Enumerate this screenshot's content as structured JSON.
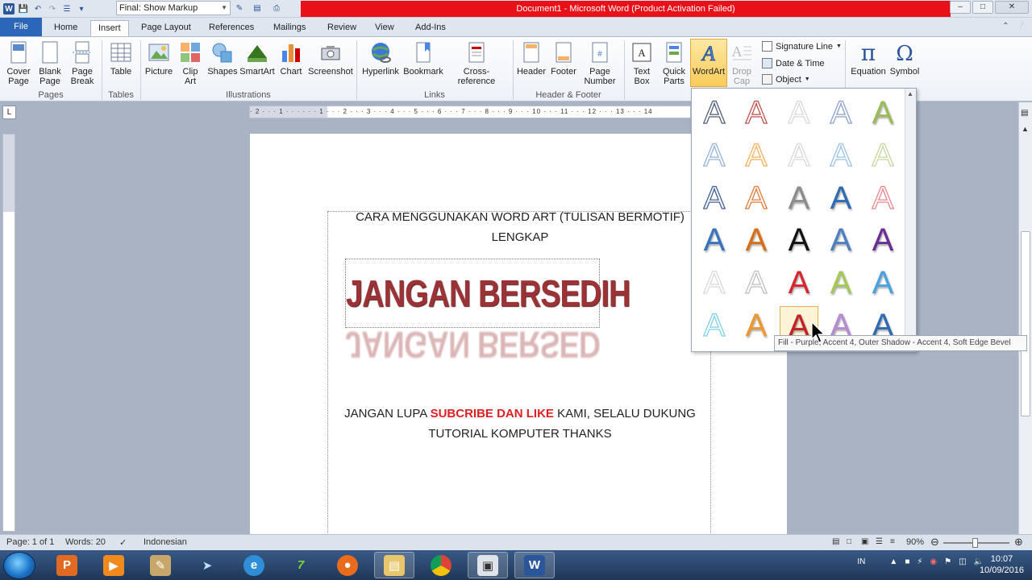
{
  "titlebar": {
    "markup_select": "Final: Show Markup",
    "window_title": "Document1  -  Microsoft Word (Product Activation Failed)"
  },
  "tabs": [
    "File",
    "Home",
    "Insert",
    "Page Layout",
    "References",
    "Mailings",
    "Review",
    "View",
    "Add-Ins"
  ],
  "ribbon": {
    "pages": {
      "cover_page": "Cover Page",
      "blank_page": "Blank Page",
      "page_break": "Page Break",
      "label": "Pages"
    },
    "tables": {
      "table": "Table",
      "label": "Tables"
    },
    "illustrations": {
      "picture": "Picture",
      "clip_art": "Clip Art",
      "shapes": "Shapes",
      "smartart": "SmartArt",
      "chart": "Chart",
      "screenshot": "Screenshot",
      "label": "Illustrations"
    },
    "links": {
      "hyperlink": "Hyperlink",
      "bookmark": "Bookmark",
      "cross_reference": "Cross-reference",
      "label": "Links"
    },
    "header_footer": {
      "header": "Header",
      "footer": "Footer",
      "page_number": "Page Number",
      "label": "Header & Footer"
    },
    "text": {
      "text_box": "Text Box",
      "quick_parts": "Quick Parts",
      "wordart": "WordArt",
      "drop_cap": "Drop Cap",
      "signature_line": "Signature Line",
      "date_time": "Date & Time",
      "object": "Object"
    },
    "symbols": {
      "equation": "Equation",
      "symbol": "Symbol"
    }
  },
  "document": {
    "heading_line1": "CARA MENGGUNAKAN  WORD ART (TULISAN BERMOTIF)",
    "heading_line2": "LENGKAP",
    "wordart": "JANGAN BERSEDIH",
    "body_prefix": "JANGAN LUPA ",
    "body_highlight": "SUBCRIBE DAN LIKE",
    "body_suffix": " KAMI, SELALU DUKUNG",
    "body_line2": "TUTORIAL KOMPUTER THANKS"
  },
  "gallery": {
    "letter": "A",
    "tooltip": "Fill - Purple, Accent 4, Outer Shadow - Accent 4, Soft Edge Bevel",
    "styles": [
      [
        "#4f5f7a",
        "outline"
      ],
      [
        "#c0504d",
        "outline"
      ],
      [
        "#d9d9d9",
        "outline"
      ],
      [
        "#8ea1c7",
        "outline"
      ],
      [
        "#9bbb59",
        "fill"
      ],
      [
        "#95b3d7",
        "outline"
      ],
      [
        "#f5b05e",
        "outline"
      ],
      [
        "#d9d9d9",
        "outline"
      ],
      [
        "#9dc3e6",
        "outline"
      ],
      [
        "#c4d79b",
        "outline"
      ],
      [
        "#3f5f90",
        "outline"
      ],
      [
        "#e07b39",
        "outline"
      ],
      [
        "#8c8c8c",
        "fill"
      ],
      [
        "#2e6bb3",
        "fill"
      ],
      [
        "#e9868a",
        "outline"
      ],
      [
        "#3a74c0",
        "fill"
      ],
      [
        "#d96f14",
        "fill"
      ],
      [
        "#111111",
        "fill"
      ],
      [
        "#4e7fc0",
        "fill"
      ],
      [
        "#6a2e94",
        "fill"
      ],
      [
        "#d9d9d9",
        "outline"
      ],
      [
        "#bfbfbf",
        "outline"
      ],
      [
        "#d7262d",
        "fill"
      ],
      [
        "#a4c955",
        "fill"
      ],
      [
        "#4aa3df",
        "fill"
      ],
      [
        "#7fd0e6",
        "outline"
      ],
      [
        "#f0962f",
        "fill"
      ],
      [
        "#c41f24",
        "fill"
      ],
      [
        "#b48ad1",
        "fill"
      ],
      [
        "#2e6bb3",
        "fill"
      ]
    ]
  },
  "statusbar": {
    "page": "Page: 1 of 1",
    "words": "Words: 20",
    "language": "Indonesian",
    "zoom": "90%"
  },
  "taskbar": {
    "lang": "IN",
    "time": "10:07",
    "date": "10/09/2016"
  }
}
